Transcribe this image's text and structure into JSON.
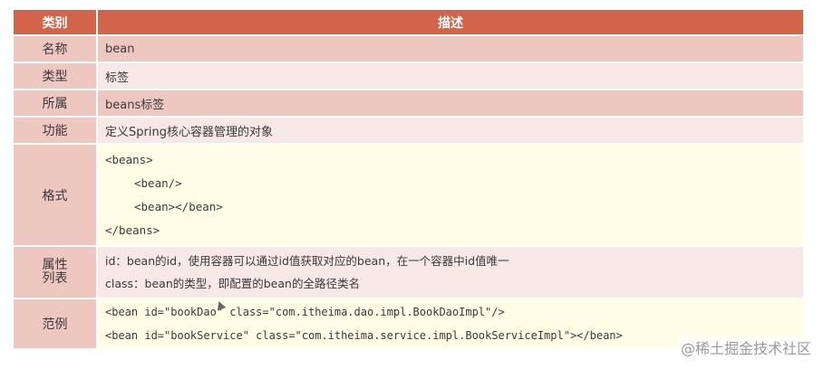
{
  "header": {
    "col1": "类别",
    "col2": "描述"
  },
  "rows": {
    "name": {
      "label": "名称",
      "value": "bean"
    },
    "type": {
      "label": "类型",
      "value": "标签"
    },
    "belongs": {
      "label": "所属",
      "value": "beans标签"
    },
    "function": {
      "label": "功能",
      "value": "定义Spring核心容器管理的对象"
    },
    "format": {
      "label": "格式",
      "lines": [
        "<beans>",
        "<bean/>",
        "<bean></bean>",
        "</beans>"
      ]
    },
    "attributes": {
      "label_line1": "属性",
      "label_line2": "列表",
      "lines": [
        "id：bean的id，使用容器可以通过id值获取对应的bean，在一个容器中id值唯一",
        "class：bean的类型，即配置的bean的全路径类名"
      ]
    },
    "example": {
      "label": "范例",
      "lines": [
        "<bean id=\"bookDao\" class=\"com.itheima.dao.impl.BookDaoImpl\"/>",
        "<bean id=\"bookService\" class=\"com.itheima.service.impl.BookServiceImpl\"></bean>"
      ]
    }
  },
  "watermark": "@稀土掘金技术社区"
}
